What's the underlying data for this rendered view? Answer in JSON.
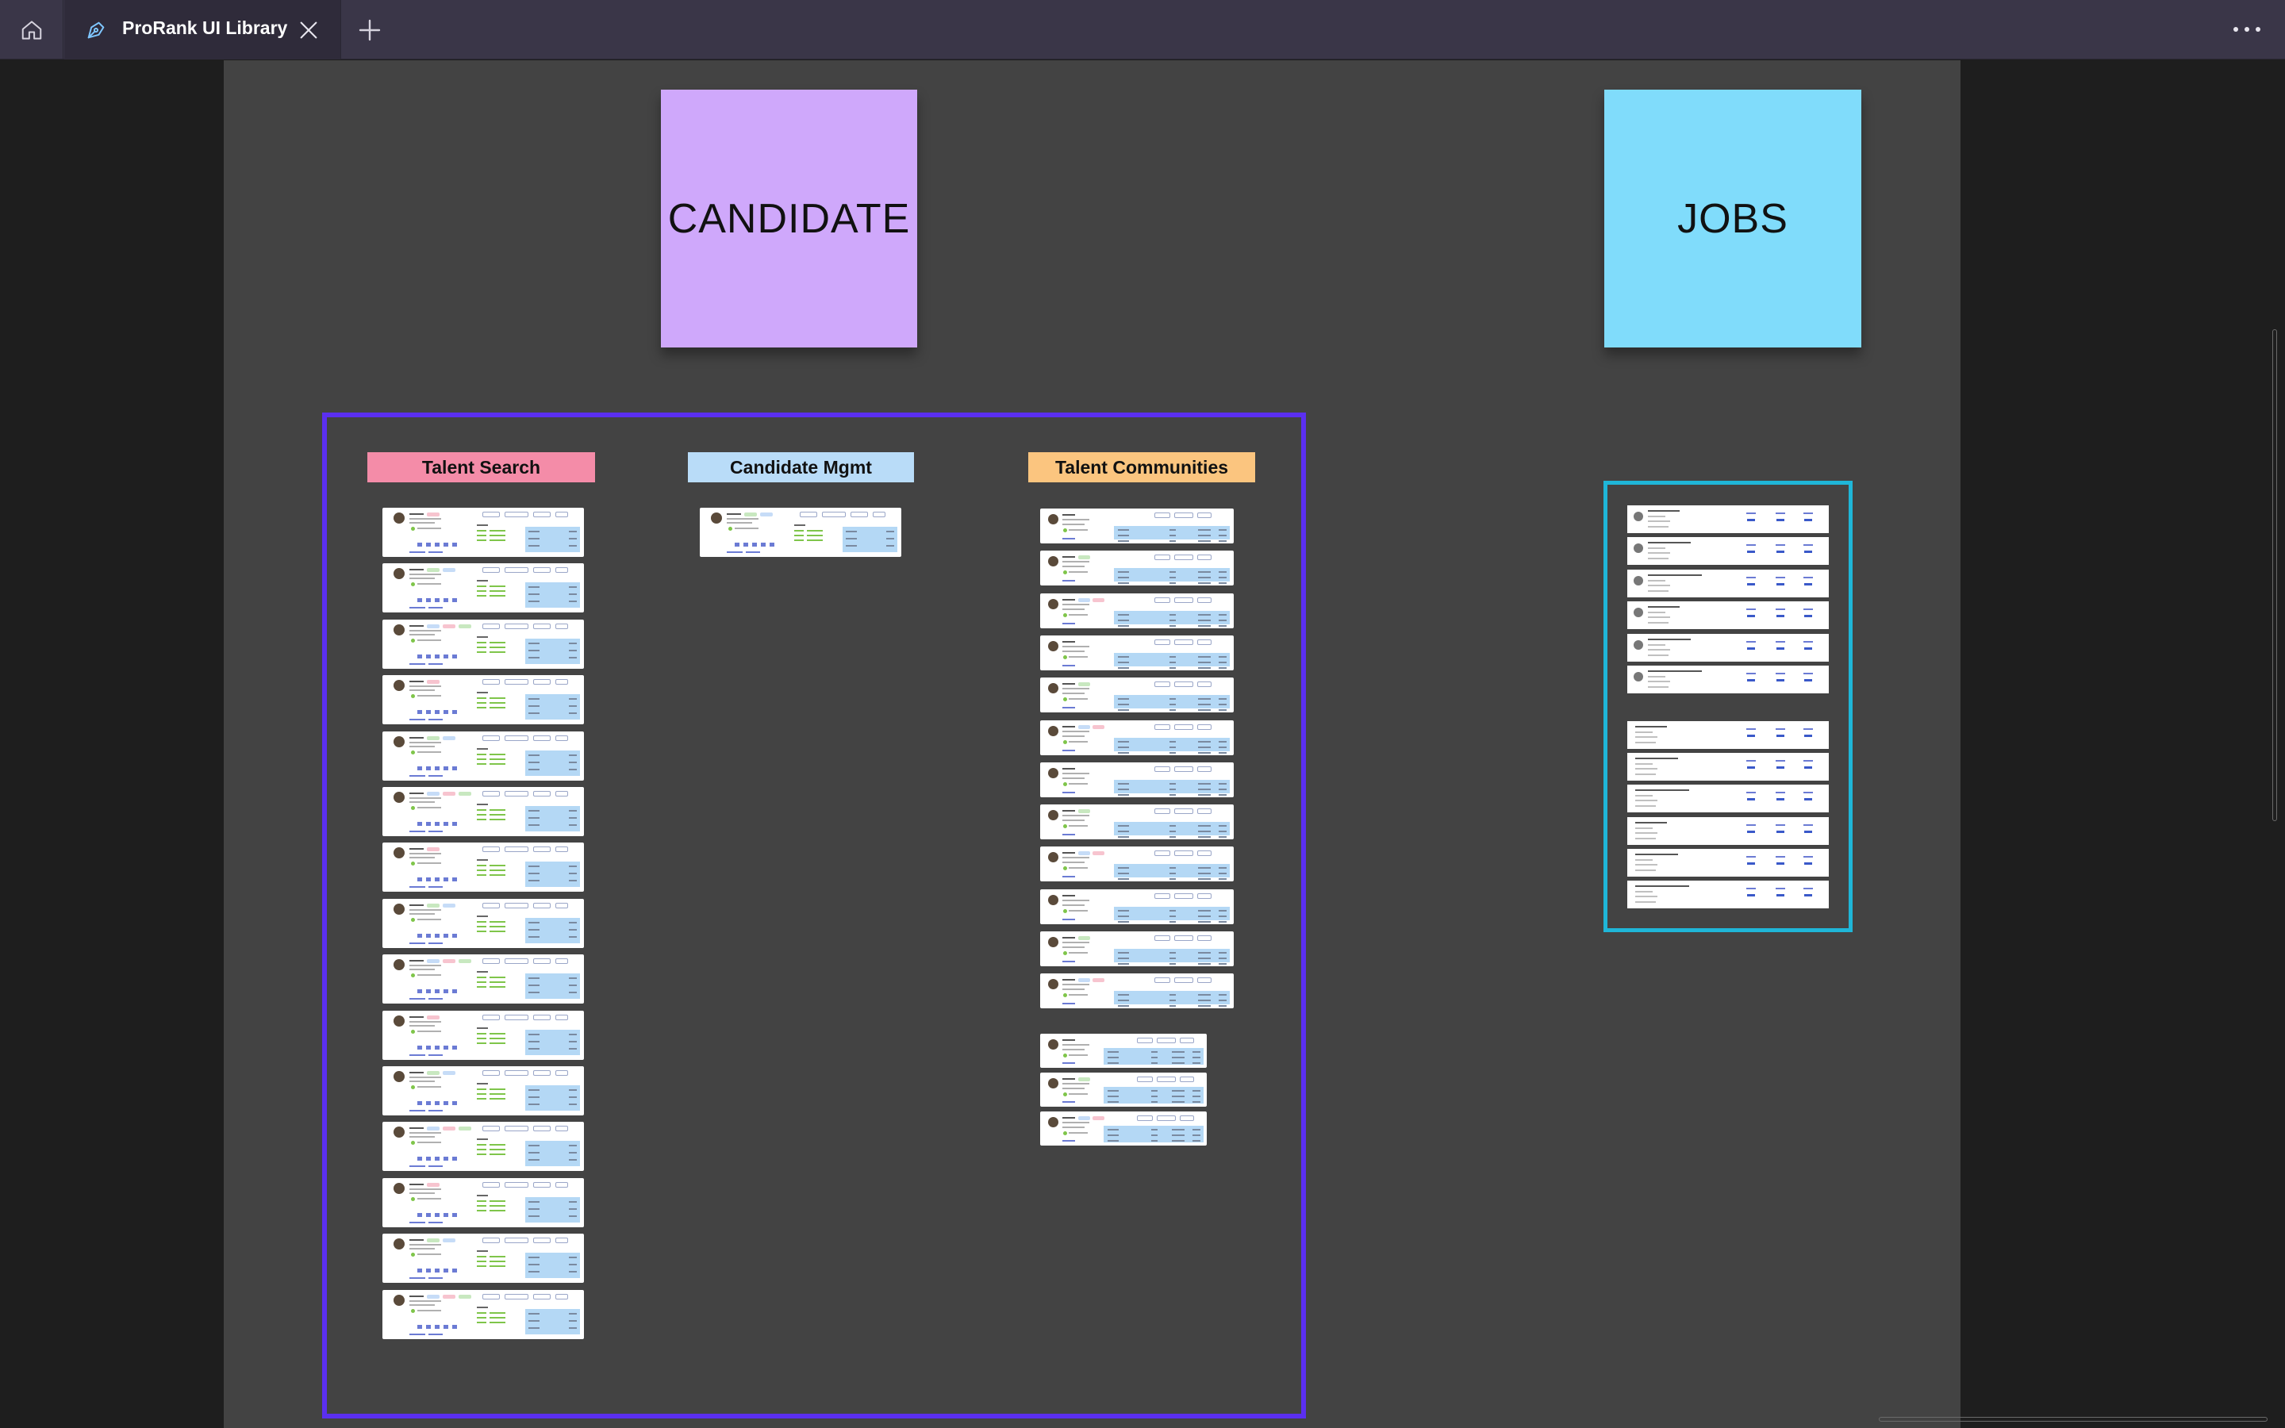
{
  "tabbar": {
    "home_icon": "home-icon",
    "tab": {
      "title": "ProRank UI Library",
      "icon": "pen-nib-icon",
      "close_icon": "close-icon"
    },
    "new_tab_icon": "plus-icon",
    "more_icon": "more-horizontal-icon"
  },
  "stickies": {
    "candidate": {
      "label": "CANDIDATE",
      "color": "#cfa8fb"
    },
    "jobs": {
      "label": "JOBS",
      "color": "#80dcfb"
    }
  },
  "section_labels": {
    "talent_search": "Talent Search",
    "candidate_mgmt": "Candidate Mgmt",
    "talent_communities": "Talent Communities"
  },
  "colors": {
    "frame_bg": "#434343",
    "section_border": "#5b2ff0",
    "jobs_border": "#1fb6d8",
    "talent_search_label": "#f48ca8",
    "candidate_mgmt_label": "#b9dcf8",
    "talent_communities_label": "#fbc57f"
  },
  "thumbnails": {
    "talent_search_count": 15,
    "candidate_mgmt_count": 1,
    "talent_communities_count": 12,
    "talent_communities_compact_count": 3,
    "jobs_with_avatar_count": 6,
    "jobs_plain_count": 6
  }
}
